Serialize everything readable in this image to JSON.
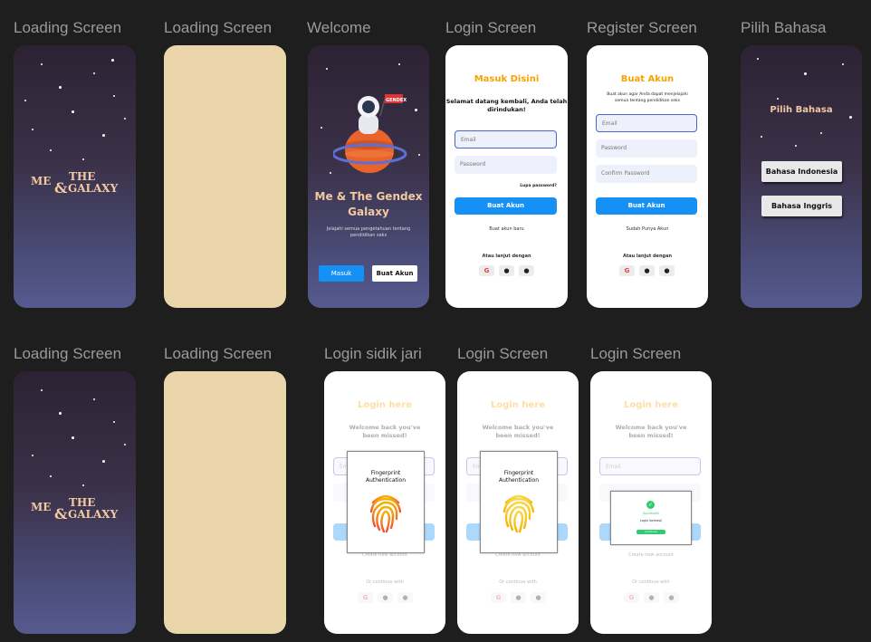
{
  "labels": {
    "loading1": "Loading Screen",
    "loading2": "Loading Screen",
    "welcome": "Welcome",
    "login": "Login Screen",
    "register": "Register Screen",
    "language": "Pilih Bahasa",
    "loading3": "Loading Screen",
    "loading4": "Loading Screen",
    "fingerprint": "Login sidik jari",
    "login2": "Login Screen",
    "login3": "Login Screen"
  },
  "logo": {
    "me": "ME",
    "amp": "&",
    "the": "THE",
    "galaxy": "GALAXY"
  },
  "welcome": {
    "flag": "GENDEX",
    "title_line1": "Me & The Gendex",
    "title_line2": "Galaxy",
    "desc_line1": "Jelajahi semua pengetahuan tentang",
    "desc_line2": "pendidikan seks",
    "login_btn": "Masuk",
    "register_btn": "Buat Akun"
  },
  "login": {
    "title": "Masuk Disini",
    "subtitle_line1": "Selamat datang kembali, Anda telah",
    "subtitle_line2": "dirindukan!",
    "email_ph": "Email",
    "password_ph": "Password",
    "forgot": "Lupa password?",
    "submit": "Buat Akun",
    "create": "Buat akun baru",
    "or": "Atau lanjut dengan"
  },
  "register": {
    "title": "Buat Akun",
    "subtitle_line1": "Buat akun agar Anda dapat menjelajahi",
    "subtitle_line2": "semua tentang pendidikan seks",
    "email_ph": "Email",
    "password_ph": "Password",
    "confirm_ph": "Confirm Password",
    "submit": "Buat Akun",
    "have_account": "Sudah Punya Akun",
    "or": "Atau lanjut dengan"
  },
  "language": {
    "title": "Pilih Bahasa",
    "opt1": "Bahasa Indonesia",
    "opt2": "Bahasa Inggris"
  },
  "fp_login": {
    "title": "Login here",
    "subtitle_line1": "Welcome back you've",
    "subtitle_line2": "been missed!",
    "email_ph": "Email",
    "create": "Create new account",
    "or": "Or continue with",
    "modal_line1": "Fingerprint",
    "modal_line2": "Authentication",
    "success_line1": "Successful",
    "success_line2": "Login berhasil",
    "success_btn": "Continue"
  },
  "colors": {
    "accent_orange": "#f5a300",
    "primary_blue": "#1591f5",
    "beige": "#ebd6ab",
    "success_green": "#2ecc71"
  }
}
